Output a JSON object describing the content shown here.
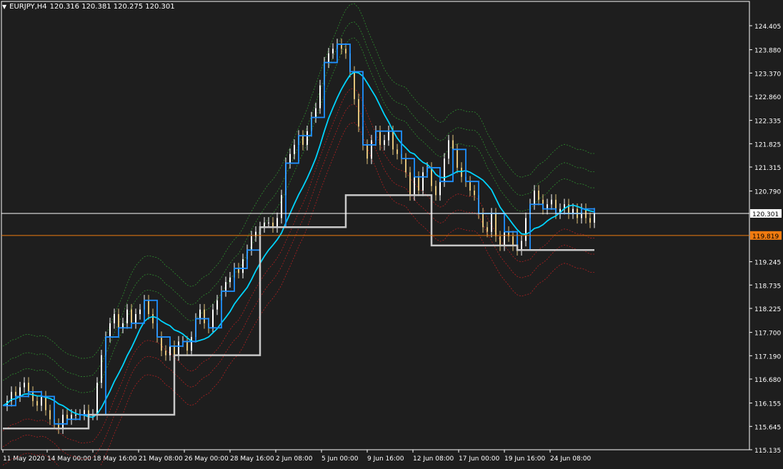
{
  "window": {
    "symbol": "EURJPY,H4",
    "ohlc": "120.316 120.381 120.275 120.301"
  },
  "chart_data": {
    "type": "candlestick",
    "symbol": "EURJPY",
    "timeframe": "H4",
    "y_ticks": [
      "124.405",
      "123.880",
      "123.370",
      "122.860",
      "122.335",
      "121.825",
      "121.315",
      "120.790",
      "120.301",
      "119.819",
      "119.245",
      "118.735",
      "118.225",
      "117.700",
      "117.190",
      "116.680",
      "116.155",
      "115.645",
      "115.135"
    ],
    "y_tick_values": [
      124.405,
      123.88,
      123.37,
      122.86,
      122.335,
      121.825,
      121.315,
      120.79,
      120.301,
      119.819,
      119.245,
      118.735,
      118.225,
      117.7,
      117.19,
      116.68,
      116.155,
      115.645,
      115.135
    ],
    "ylim": [
      115.135,
      124.405
    ],
    "x_ticks": [
      "11 May 2020",
      "14 May 00:00",
      "18 May 16:00",
      "21 May 08:00",
      "26 May 00:00",
      "28 May 16:00",
      "2 Jun 08:00",
      "5 Jun 00:00",
      "9 Jun 16:00",
      "12 Jun 08:00",
      "17 Jun 00:00",
      "19 Jun 16:00",
      "24 Jun 08:00"
    ],
    "price_lines": [
      {
        "label": "120.301",
        "value": 120.301,
        "color": "#ffffff",
        "bg": "#ffffff",
        "text_color": "#000000"
      },
      {
        "label": "119.819",
        "value": 119.819,
        "color": "#f07b10",
        "bg": "#f07b10",
        "text_color": "#000000"
      }
    ],
    "colors": {
      "background": "#1e1e1e",
      "grid_text": "#ffffff",
      "candle_up": "#ffffff",
      "candle_down": "#e0c27a",
      "ma_fast": "#1e90ff",
      "ma_slow": "#00d4ff",
      "step_line": "#c8c8c8",
      "band_upper": "#2e8b2e",
      "band_lower": "#b02020"
    },
    "series": [
      {
        "kind": "close_path",
        "points": [
          [
            0,
            116.1
          ],
          [
            6,
            116.2
          ],
          [
            12,
            116.4
          ],
          [
            18,
            116.3
          ],
          [
            24,
            116.5
          ],
          [
            30,
            116.6
          ],
          [
            36,
            116.4
          ],
          [
            42,
            116.2
          ],
          [
            48,
            116.1
          ],
          [
            54,
            116.3
          ],
          [
            60,
            116.0
          ],
          [
            66,
            115.8
          ],
          [
            72,
            115.7
          ],
          [
            78,
            115.6
          ],
          [
            84,
            115.9
          ],
          [
            90,
            115.8
          ],
          [
            96,
            115.9
          ],
          [
            102,
            115.9
          ],
          [
            108,
            115.9
          ],
          [
            114,
            116.0
          ],
          [
            120,
            115.9
          ],
          [
            126,
            115.9
          ],
          [
            132,
            116.6
          ],
          [
            138,
            117.2
          ],
          [
            144,
            117.6
          ],
          [
            150,
            117.9
          ],
          [
            156,
            118.1
          ],
          [
            162,
            117.8
          ],
          [
            168,
            117.9
          ],
          [
            174,
            118.2
          ],
          [
            180,
            117.9
          ],
          [
            186,
            118.1
          ],
          [
            192,
            118.2
          ],
          [
            198,
            118.4
          ],
          [
            204,
            118.1
          ],
          [
            210,
            117.9
          ],
          [
            216,
            117.6
          ],
          [
            222,
            117.3
          ],
          [
            228,
            117.2
          ],
          [
            234,
            117.4
          ],
          [
            240,
            117.2
          ],
          [
            246,
            117.5
          ],
          [
            252,
            117.5
          ],
          [
            258,
            117.3
          ],
          [
            264,
            117.6
          ],
          [
            270,
            118.0
          ],
          [
            276,
            118.2
          ],
          [
            282,
            117.9
          ],
          [
            288,
            117.8
          ],
          [
            294,
            118.2
          ],
          [
            300,
            118.4
          ],
          [
            306,
            118.6
          ],
          [
            312,
            118.8
          ],
          [
            318,
            118.9
          ],
          [
            324,
            119.1
          ],
          [
            330,
            119.0
          ],
          [
            336,
            119.3
          ],
          [
            342,
            119.5
          ],
          [
            348,
            119.8
          ],
          [
            354,
            119.9
          ],
          [
            360,
            120.0
          ],
          [
            366,
            120.1
          ],
          [
            372,
            120.1
          ],
          [
            378,
            120.0
          ],
          [
            384,
            120.2
          ],
          [
            390,
            120.7
          ],
          [
            396,
            121.4
          ],
          [
            402,
            121.6
          ],
          [
            408,
            121.8
          ],
          [
            414,
            122.0
          ],
          [
            420,
            121.8
          ],
          [
            426,
            122.1
          ],
          [
            432,
            122.4
          ],
          [
            438,
            122.6
          ],
          [
            444,
            123.1
          ],
          [
            450,
            123.6
          ],
          [
            456,
            123.8
          ],
          [
            462,
            123.9
          ],
          [
            468,
            124.0
          ],
          [
            474,
            123.9
          ],
          [
            480,
            123.8
          ],
          [
            486,
            123.4
          ],
          [
            492,
            122.8
          ],
          [
            498,
            122.2
          ],
          [
            504,
            121.8
          ],
          [
            510,
            121.5
          ],
          [
            516,
            121.9
          ],
          [
            522,
            122.1
          ],
          [
            528,
            121.8
          ],
          [
            534,
            121.9
          ],
          [
            540,
            122.1
          ],
          [
            546,
            121.7
          ],
          [
            552,
            121.6
          ],
          [
            558,
            121.5
          ],
          [
            564,
            121.2
          ],
          [
            570,
            120.7
          ],
          [
            576,
            121.1
          ],
          [
            582,
            120.8
          ],
          [
            588,
            121.2
          ],
          [
            594,
            121.3
          ],
          [
            600,
            120.9
          ],
          [
            606,
            120.7
          ],
          [
            612,
            121.0
          ],
          [
            618,
            121.5
          ],
          [
            624,
            121.9
          ],
          [
            630,
            121.7
          ],
          [
            636,
            121.3
          ],
          [
            642,
            121.1
          ],
          [
            648,
            121.0
          ],
          [
            654,
            120.8
          ],
          [
            660,
            120.7
          ],
          [
            666,
            120.3
          ],
          [
            672,
            120.0
          ],
          [
            678,
            119.9
          ],
          [
            684,
            120.3
          ],
          [
            690,
            119.8
          ],
          [
            696,
            119.6
          ],
          [
            702,
            119.9
          ],
          [
            708,
            119.8
          ],
          [
            714,
            119.6
          ],
          [
            720,
            119.5
          ],
          [
            726,
            119.7
          ],
          [
            732,
            120.2
          ],
          [
            738,
            120.5
          ],
          [
            744,
            120.8
          ],
          [
            750,
            120.6
          ],
          [
            756,
            120.4
          ],
          [
            762,
            120.5
          ],
          [
            768,
            120.6
          ],
          [
            774,
            120.3
          ],
          [
            780,
            120.4
          ],
          [
            786,
            120.5
          ],
          [
            792,
            120.3
          ],
          [
            798,
            120.4
          ],
          [
            804,
            120.2
          ],
          [
            810,
            120.4
          ],
          [
            816,
            120.2
          ],
          [
            822,
            120.1
          ],
          [
            828,
            120.3
          ]
        ]
      }
    ]
  }
}
